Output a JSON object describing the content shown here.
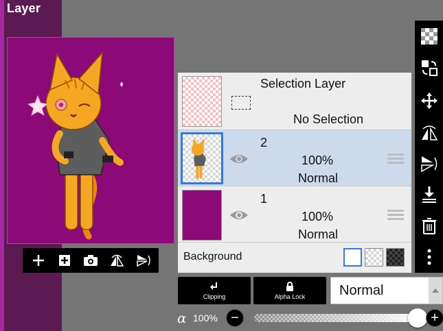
{
  "panel": {
    "title": "Layer"
  },
  "preview_toolbar": {
    "icons": [
      "add-layer-icon",
      "add-image-layer-icon",
      "camera-icon",
      "flip-horizontal-icon",
      "flip-vertical-icon"
    ]
  },
  "selection_layer": {
    "title": "Selection Layer",
    "status": "No Selection"
  },
  "layers": [
    {
      "number": "2",
      "opacity": "100%",
      "blend": "Normal",
      "selected": true
    },
    {
      "number": "1",
      "opacity": "100%",
      "blend": "Normal",
      "selected": false,
      "fill_color": "#8c0a78"
    }
  ],
  "background": {
    "label": "Background",
    "options": [
      "white",
      "transparent",
      "dark"
    ],
    "selected": "white"
  },
  "right_toolbar": {
    "icons": [
      "transparency-icon",
      "move-layer-icon",
      "move-icon",
      "flip-horizontal-icon",
      "flip-vertical-icon",
      "merge-down-icon",
      "trash-icon",
      "more-icon"
    ]
  },
  "bottom": {
    "clipping_label": "Clipping",
    "alpha_lock_label": "Alpha Lock",
    "blend_mode": "Normal",
    "alpha_symbol": "α",
    "opacity_label": "100%",
    "opacity_value": 1.0,
    "minus": "−",
    "plus": "+"
  },
  "colors": {
    "accent": "#2f7be0",
    "canvas": "#8c0a78",
    "sidebar": "#5b1b52"
  }
}
